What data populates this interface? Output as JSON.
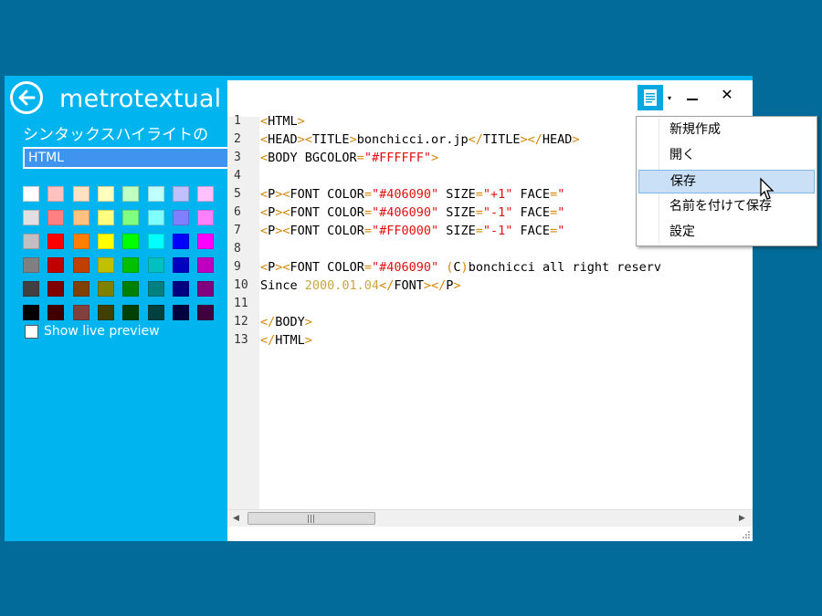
{
  "app": {
    "title": "metrotextual",
    "section_title": "シンタックスハイライトの",
    "language_selected": "HTML",
    "live_preview_label": "Show live preview",
    "live_preview_checked": false
  },
  "swatches": [
    [
      "#ffffff",
      "#ffc0c0",
      "#ffe0c0",
      "#ffffc0",
      "#c0ffc0",
      "#c0ffff",
      "#c0c0ff",
      "#ffc0ff"
    ],
    [
      "#e0e0e0",
      "#ff8080",
      "#ffc080",
      "#ffff80",
      "#80ff80",
      "#80ffff",
      "#8080ff",
      "#ff80ff"
    ],
    [
      "#c0c0c0",
      "#ff0000",
      "#ff8000",
      "#ffff00",
      "#00ff00",
      "#00ffff",
      "#0000ff",
      "#ff00ff"
    ],
    [
      "#808080",
      "#c00000",
      "#c04000",
      "#c0c000",
      "#00c000",
      "#00c0c0",
      "#0000c0",
      "#c000c0"
    ],
    [
      "#404040",
      "#800000",
      "#804000",
      "#808000",
      "#008000",
      "#008080",
      "#000080",
      "#800080"
    ],
    [
      "#000000",
      "#400000",
      "#804040",
      "#404000",
      "#004000",
      "#004040",
      "#000040",
      "#400040"
    ]
  ],
  "editor": {
    "line_numbers": [
      "1",
      "2",
      "3",
      "4",
      "5",
      "6",
      "7",
      "8",
      "9",
      "10",
      "11",
      "12",
      "13"
    ],
    "lines": [
      [
        {
          "c": "k",
          "t": "<"
        },
        {
          "c": "t",
          "t": "HTML"
        },
        {
          "c": "k",
          "t": ">"
        }
      ],
      [
        {
          "c": "k",
          "t": "<"
        },
        {
          "c": "t",
          "t": "HEAD"
        },
        {
          "c": "k",
          "t": "><"
        },
        {
          "c": "t",
          "t": "TITLE"
        },
        {
          "c": "k",
          "t": ">"
        },
        {
          "c": "t",
          "t": "bonchicci.or.jp"
        },
        {
          "c": "k",
          "t": "</"
        },
        {
          "c": "t",
          "t": "TITLE"
        },
        {
          "c": "k",
          "t": "></"
        },
        {
          "c": "t",
          "t": "HEAD"
        },
        {
          "c": "k",
          "t": ">"
        }
      ],
      [
        {
          "c": "k",
          "t": "<"
        },
        {
          "c": "t",
          "t": "BODY BGCOLOR"
        },
        {
          "c": "k",
          "t": "="
        },
        {
          "c": "s",
          "t": "\"#FFFFFF\""
        },
        {
          "c": "k",
          "t": ">"
        }
      ],
      [],
      [
        {
          "c": "k",
          "t": "<"
        },
        {
          "c": "t",
          "t": "P"
        },
        {
          "c": "k",
          "t": "><"
        },
        {
          "c": "t",
          "t": "FONT COLOR"
        },
        {
          "c": "k",
          "t": "="
        },
        {
          "c": "s",
          "t": "\"#406090\""
        },
        {
          "c": "t",
          "t": " SIZE"
        },
        {
          "c": "k",
          "t": "="
        },
        {
          "c": "s",
          "t": "\"+1\""
        },
        {
          "c": "t",
          "t": " FACE"
        },
        {
          "c": "k",
          "t": "="
        },
        {
          "c": "s",
          "t": "\""
        }
      ],
      [
        {
          "c": "k",
          "t": "<"
        },
        {
          "c": "t",
          "t": "P"
        },
        {
          "c": "k",
          "t": "><"
        },
        {
          "c": "t",
          "t": "FONT COLOR"
        },
        {
          "c": "k",
          "t": "="
        },
        {
          "c": "s",
          "t": "\"#406090\""
        },
        {
          "c": "t",
          "t": " SIZE"
        },
        {
          "c": "k",
          "t": "="
        },
        {
          "c": "s",
          "t": "\"-1\""
        },
        {
          "c": "t",
          "t": " FACE"
        },
        {
          "c": "k",
          "t": "="
        },
        {
          "c": "s",
          "t": "\""
        }
      ],
      [
        {
          "c": "k",
          "t": "<"
        },
        {
          "c": "t",
          "t": "P"
        },
        {
          "c": "k",
          "t": "><"
        },
        {
          "c": "t",
          "t": "FONT COLOR"
        },
        {
          "c": "k",
          "t": "="
        },
        {
          "c": "s",
          "t": "\"#FF0000\""
        },
        {
          "c": "t",
          "t": " SIZE"
        },
        {
          "c": "k",
          "t": "="
        },
        {
          "c": "s",
          "t": "\"-1\""
        },
        {
          "c": "t",
          "t": " FACE"
        },
        {
          "c": "k",
          "t": "="
        },
        {
          "c": "s",
          "t": "\""
        }
      ],
      [],
      [
        {
          "c": "k",
          "t": "<"
        },
        {
          "c": "t",
          "t": "P"
        },
        {
          "c": "k",
          "t": "><"
        },
        {
          "c": "t",
          "t": "FONT COLOR"
        },
        {
          "c": "k",
          "t": "="
        },
        {
          "c": "s",
          "t": "\"#406090\""
        },
        {
          "c": "t",
          "t": " "
        },
        {
          "c": "k",
          "t": "("
        },
        {
          "c": "t",
          "t": "C"
        },
        {
          "c": "k",
          "t": ")"
        },
        {
          "c": "t",
          "t": "bonchicci all right reserv"
        }
      ],
      [
        {
          "c": "t",
          "t": "Since "
        },
        {
          "c": "d",
          "t": "2000.01.04"
        },
        {
          "c": "k",
          "t": "</"
        },
        {
          "c": "t",
          "t": "FONT"
        },
        {
          "c": "k",
          "t": "></"
        },
        {
          "c": "t",
          "t": "P"
        },
        {
          "c": "k",
          "t": ">"
        }
      ],
      [],
      [
        {
          "c": "k",
          "t": "</"
        },
        {
          "c": "t",
          "t": "BODY"
        },
        {
          "c": "k",
          "t": ">"
        }
      ],
      [
        {
          "c": "k",
          "t": "</"
        },
        {
          "c": "t",
          "t": "HTML"
        },
        {
          "c": "k",
          "t": ">"
        }
      ]
    ]
  },
  "window_buttons": {
    "minimize": "–",
    "close": "✕"
  },
  "menu": {
    "items": [
      {
        "label": "新規作成",
        "highlighted": false
      },
      {
        "label": "開く",
        "highlighted": false
      },
      {
        "label": "保存",
        "highlighted": true
      },
      {
        "label": "名前を付けて保存",
        "highlighted": false
      },
      {
        "label": "設定",
        "highlighted": false
      }
    ]
  },
  "colors": {
    "desktop": "#036b99",
    "panel": "#00b4f0",
    "tag": "#d4880a",
    "string": "#e01010",
    "date": "#c9a640"
  }
}
